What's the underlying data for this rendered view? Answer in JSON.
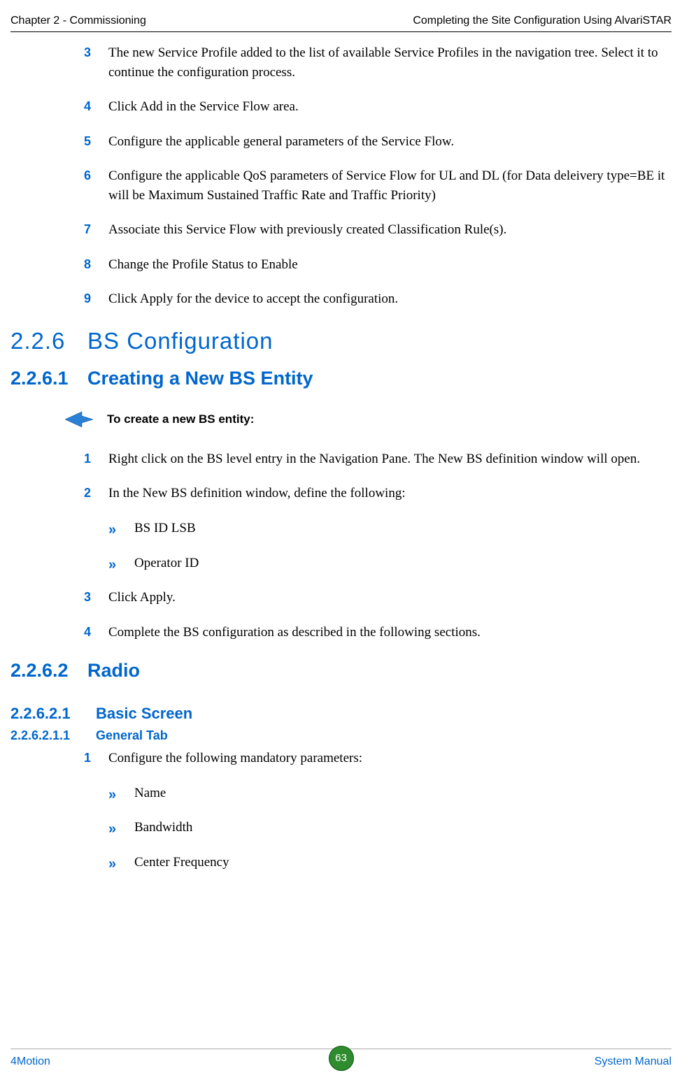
{
  "header": {
    "left": "Chapter 2 - Commissioning",
    "right": "Completing the Site Configuration Using AlvariSTAR"
  },
  "list1": [
    {
      "n": "3",
      "t": "The new Service Profile added to the list of available Service Profiles in the navigation tree. Select it to continue the configuration process."
    },
    {
      "n": "4",
      "t": "Click Add in the Service Flow area."
    },
    {
      "n": "5",
      "t": "Configure the applicable general parameters of the Service Flow."
    },
    {
      "n": "6",
      "t": "Configure the applicable QoS parameters of Service Flow for UL and DL (for Data deleivery type=BE it will be Maximum Sustained Traffic Rate and Traffic Priority)"
    },
    {
      "n": "7",
      "t": "Associate this Service Flow with previously created Classification Rule(s)."
    },
    {
      "n": "8",
      "t": "Change the Profile Status to Enable"
    },
    {
      "n": "9",
      "t": "Click Apply for the device to accept the configuration."
    }
  ],
  "sec226": {
    "n": "2.2.6",
    "t": "BS Configuration"
  },
  "sec2261": {
    "n": "2.2.6.1",
    "t": "Creating a New BS Entity"
  },
  "callout1": "To create a new BS entity:",
  "list2": [
    {
      "n": "1",
      "t": "Right click on the BS level entry in the Navigation Pane. The New BS definition window will open."
    },
    {
      "n": "2",
      "t": "In the New BS definition window, define the following:"
    }
  ],
  "bullets2": [
    "BS ID LSB",
    "Operator ID"
  ],
  "list2b": [
    {
      "n": "3",
      "t": "Click Apply."
    },
    {
      "n": "4",
      "t": "Complete the BS configuration as described in the following sections."
    }
  ],
  "sec2262": {
    "n": "2.2.6.2",
    "t": "Radio"
  },
  "sec22621": {
    "n": "2.2.6.2.1",
    "t": "Basic Screen"
  },
  "sec226211": {
    "n": "2.2.6.2.1.1",
    "t": "General Tab"
  },
  "list3": [
    {
      "n": "1",
      "t": "Configure the following mandatory parameters:"
    }
  ],
  "bullets3": [
    "Name",
    "Bandwidth",
    "Center Frequency"
  ],
  "footer": {
    "left": "4Motion",
    "page": "63",
    "right": "System Manual"
  }
}
